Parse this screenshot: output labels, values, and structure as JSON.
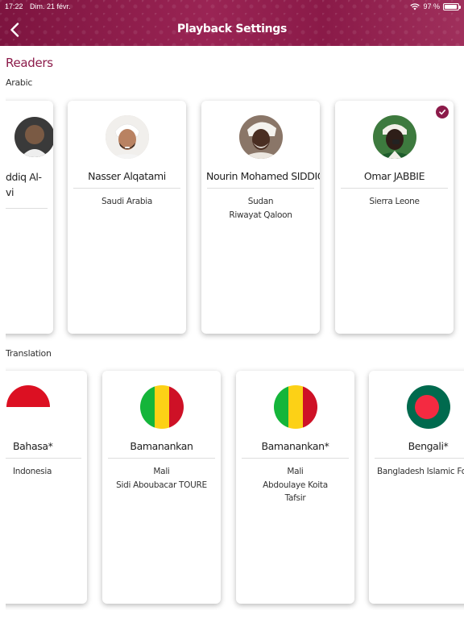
{
  "status_bar": {
    "time": "17:22",
    "date": "Dim. 21 févr.",
    "battery": "97 %"
  },
  "header": {
    "title": "Playback Settings"
  },
  "readers": {
    "section_title": "Readers",
    "group_label": "Arabic",
    "cards": [
      {
        "name_line1": "ddiq Al-",
        "name_line2": "vi",
        "info": [],
        "selected": false
      },
      {
        "name": "Nasser Alqatami",
        "info": [
          "Saudi Arabia"
        ],
        "selected": false
      },
      {
        "name": "Nourin Mohamed SIDDIQ",
        "info": [
          "Sudan",
          "Riwayat Qaloon"
        ],
        "selected": false
      },
      {
        "name": "Omar JABBIE",
        "info": [
          "Sierra Leone"
        ],
        "selected": true
      }
    ]
  },
  "translation": {
    "group_label": "Translation",
    "cards": [
      {
        "name": "Bahasa*",
        "info": [
          "Indonesia"
        ],
        "flag": "indonesia-flag"
      },
      {
        "name": "Bamanankan",
        "info": [
          "Mali",
          "Sidi Aboubacar TOURE"
        ],
        "flag": "mali-flag"
      },
      {
        "name": "Bamanankan*",
        "info": [
          "Mali",
          "Abdoulaye Koita",
          "Tafsir"
        ],
        "flag": "mali-flag"
      },
      {
        "name": "Bengali*",
        "info": [
          "Bangladesh Islamic Foun"
        ],
        "flag": "bangladesh-flag"
      }
    ]
  },
  "colors": {
    "accent": "#8c1b4a",
    "mali_green": "#14b53a",
    "mali_yellow": "#fcd116",
    "mali_red": "#ce1126",
    "bangladesh_green": "#006a4e",
    "bangladesh_red": "#f42a41",
    "indonesia_red": "#dc1022"
  }
}
